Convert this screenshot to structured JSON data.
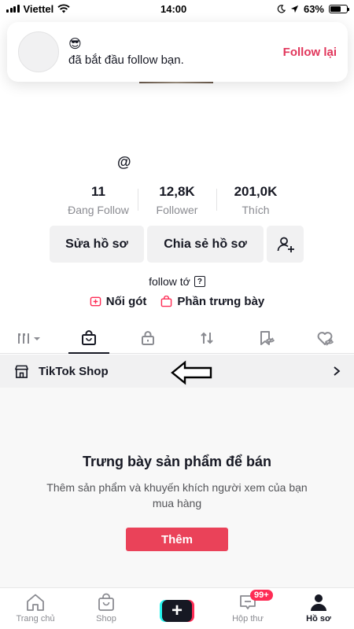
{
  "status_bar": {
    "carrier": "Viettel",
    "time": "14:00",
    "battery": "63%",
    "battery_level": 0.63
  },
  "notification": {
    "emoji": "😎",
    "message": "đã bắt đầu follow bạn.",
    "action": "Follow lại"
  },
  "profile": {
    "handle": "@",
    "stats": [
      {
        "value": "11",
        "label": "Đang Follow"
      },
      {
        "value": "12,8K",
        "label": "Follower"
      },
      {
        "value": "201,0K",
        "label": "Thích"
      }
    ],
    "edit_label": "Sửa hồ sơ",
    "share_label": "Chia sẻ hồ sơ",
    "bio": "follow tớ",
    "bio_icon_text": "?",
    "link_1": "Nối gót",
    "link_2": "Phần trưng bày"
  },
  "tabs": [
    {
      "icon": "grid-icon",
      "active": false
    },
    {
      "icon": "shopping-bag-icon",
      "active": true
    },
    {
      "icon": "lock-icon",
      "active": false
    },
    {
      "icon": "repost-icon",
      "active": false
    },
    {
      "icon": "favorites-icon",
      "active": false
    },
    {
      "icon": "liked-icon",
      "active": false
    }
  ],
  "shop": {
    "title": "TikTok Shop"
  },
  "empty_state": {
    "title": "Trưng bày sản phẩm để bán",
    "description": "Thêm sản phẩm và khuyến khích người xem của bạn mua hàng",
    "button": "Thêm"
  },
  "bottom_nav": {
    "home": "Trang chủ",
    "shop": "Shop",
    "create": "+",
    "inbox": "Hộp thư",
    "inbox_badge": "99+",
    "profile": "Hồ sơ"
  },
  "colors": {
    "accent": "#fe2c55",
    "follow_back": "#e1365b",
    "add_button": "#ea4259",
    "text": "#161823",
    "muted": "#8a8b91"
  }
}
